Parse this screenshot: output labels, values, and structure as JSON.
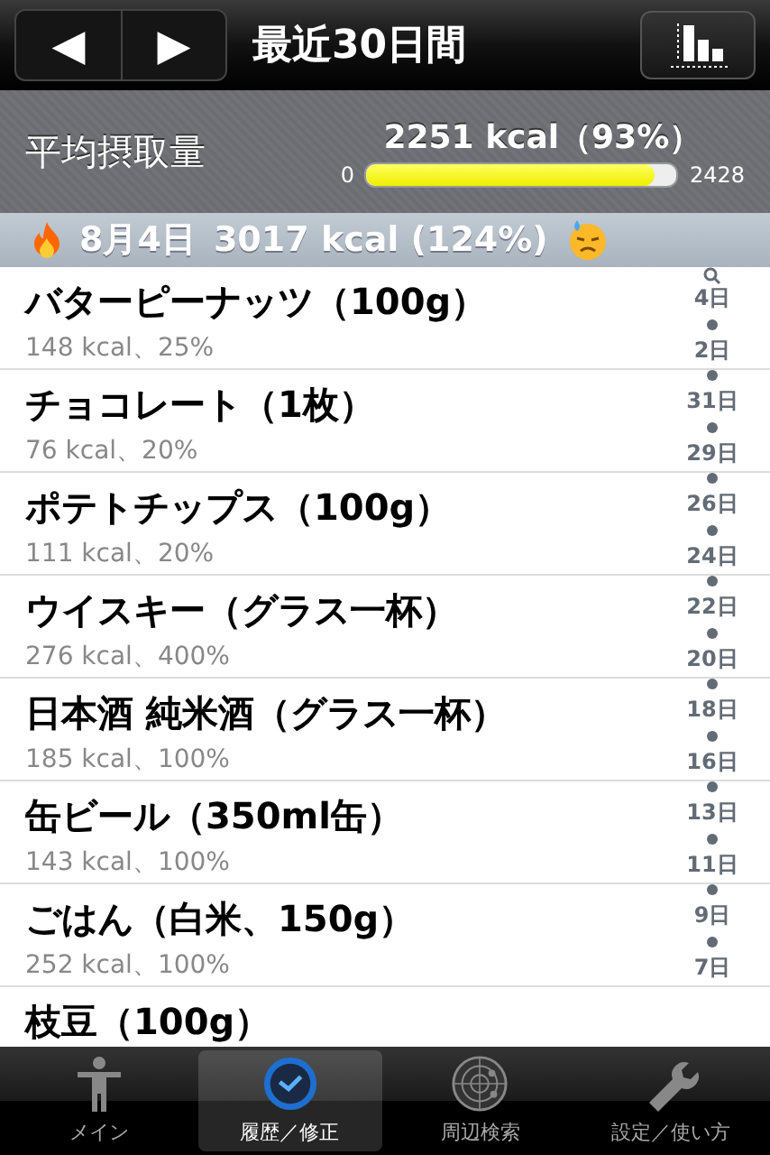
{
  "nav": {
    "prev": "◀",
    "next": "▶",
    "title": "最近30日間"
  },
  "summary": {
    "label": "平均摂取量",
    "value": "2251 kcal（93%）",
    "min": "0",
    "max": "2428",
    "level": 0.93
  },
  "section": {
    "date": "8月4日",
    "total": "3017 kcal (124%)"
  },
  "items": [
    {
      "name": "バターピーナッツ（100g）",
      "detail": "148 kcal、25%"
    },
    {
      "name": "チョコレート（1枚）",
      "detail": "76 kcal、20%"
    },
    {
      "name": "ポテトチップス（100g）",
      "detail": "111 kcal、20%"
    },
    {
      "name": "ウイスキー（グラス一杯）",
      "detail": "276 kcal、400%"
    },
    {
      "name": "日本酒 純米酒（グラス一杯）",
      "detail": "185 kcal、100%"
    },
    {
      "name": "缶ビール（350ml缶）",
      "detail": "143 kcal、100%"
    },
    {
      "name": "ごはん（白米、150g）",
      "detail": "252 kcal、100%"
    },
    {
      "name": "枝豆（100g）"
    }
  ],
  "index": [
    "4日",
    "2日",
    "31日",
    "29日",
    "26日",
    "24日",
    "22日",
    "20日",
    "18日",
    "16日",
    "13日",
    "11日",
    "9日",
    "7日"
  ],
  "tabs": [
    {
      "label": "メイン",
      "selected": false
    },
    {
      "label": "履歴／修正",
      "selected": true
    },
    {
      "label": "周辺検索",
      "selected": false
    },
    {
      "label": "設定／使い方",
      "selected": false
    }
  ]
}
